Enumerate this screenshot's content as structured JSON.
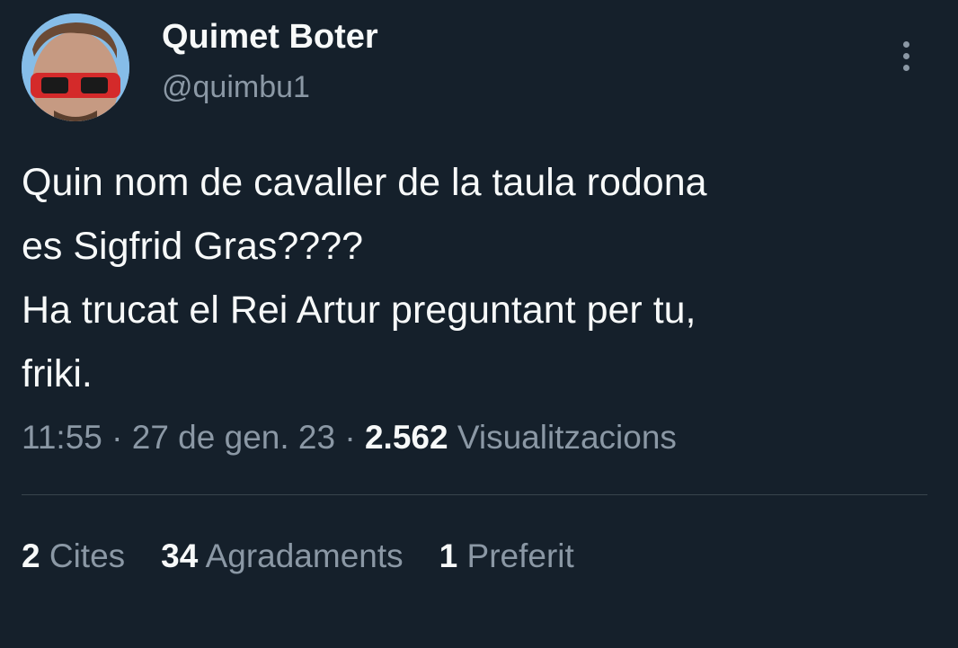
{
  "author": {
    "display_name": "Quimet Boter",
    "handle": "@quimbu1"
  },
  "tweet": {
    "lines": [
      "Quin nom de cavaller de la taula rodona",
      "es Sigfrid Gras????",
      "Ha trucat el Rei Artur preguntant per tu,",
      "friki."
    ]
  },
  "meta": {
    "time": "11:55",
    "separator": "·",
    "date": "27 de gen. 23",
    "views_count": "2.562",
    "views_label": "Visualitzacions"
  },
  "stats": {
    "quotes_count": "2",
    "quotes_label": "Cites",
    "likes_count": "34",
    "likes_label": "Agradaments",
    "bookmarks_count": "1",
    "bookmarks_label": "Preferit"
  },
  "icons": {
    "more": "more-vertical-icon"
  },
  "colors": {
    "background": "#15202b",
    "primary_text": "#f7f9f9",
    "secondary_text": "#8b98a5",
    "divider": "#38444d"
  }
}
